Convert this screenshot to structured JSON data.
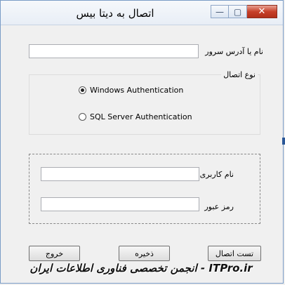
{
  "window": {
    "title": "اتصال به دیتا بیس"
  },
  "controls": {
    "minimize": "—",
    "maximize": "▢",
    "close": "✕"
  },
  "server": {
    "label": "نام یا آدرس سرور",
    "value": ""
  },
  "connection_type": {
    "legend": "نوع اتصال",
    "options": [
      {
        "label": "Windows Authentication",
        "checked": true
      },
      {
        "label": "SQL Server Authentication",
        "checked": false
      }
    ]
  },
  "credentials": {
    "username_label": "نام کاربری",
    "username_value": "",
    "password_label": "رمز عبور",
    "password_value": ""
  },
  "buttons": {
    "exit": "خروج",
    "save": "ذخیره",
    "test": "تست اتصال"
  },
  "watermark": "ITPro.ir - انجمن تخصصی فناوری اطلاعات ایران"
}
